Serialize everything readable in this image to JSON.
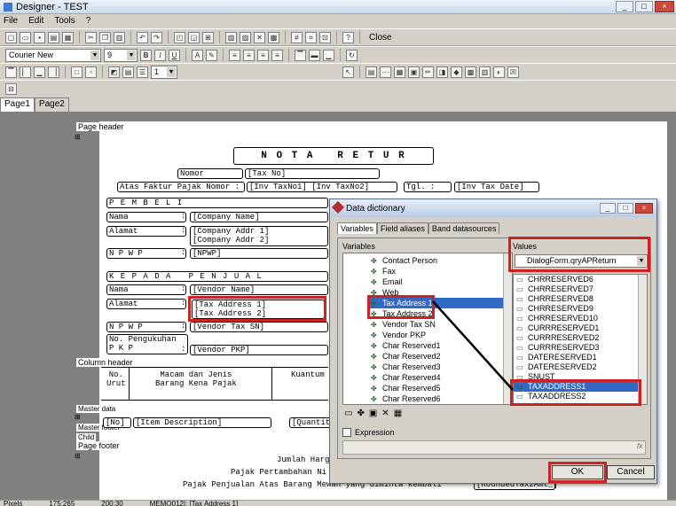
{
  "window": {
    "title": "Designer - TEST",
    "controls": [
      "_",
      "□",
      "×"
    ]
  },
  "menu": [
    "File",
    "Edit",
    "Tools",
    "?"
  ],
  "toolbar1": {
    "close_label": "Close"
  },
  "toolbar2": {
    "font": "Courier New",
    "size": "9",
    "bold": "B",
    "italic": "I",
    "underline": "U"
  },
  "toolbar3": {
    "line_width": "1"
  },
  "tabs": [
    "Page1",
    "Page2"
  ],
  "bands": {
    "page_header": "Page header",
    "column_header": "Column header",
    "master_data": "Master data",
    "master_footer": "Master footer",
    "child": "Child",
    "page_footer": "Page footer"
  },
  "report": {
    "title": "N O T A   R E T U R",
    "nomor_label": "Nomor",
    "nomor_value": "[Tax No]",
    "faktur_label": "Atas Faktur Pajak Nomor :",
    "faktur_value": "[Inv TaxNo1] [Inv TaxNo2]",
    "tgl_label": "Tgl. :",
    "tgl_value": "[Inv Tax Date]",
    "pembeli": "P E M B E L I",
    "nama": "Nama",
    "company_name": "[Company Name]",
    "alamat": "Alamat",
    "company_addr": "[Company Addr 1]\n[Company Addr 2]",
    "npwp": "N P W P",
    "npwp_value": "[NPWP]",
    "kepada": "K E P A D A   P E N J U A L",
    "vendor_name": "[Vendor Name]",
    "tax_address": "[Tax Address 1]\n[Tax Address 2]",
    "vendor_tax": "[Vendor Tax SN]",
    "pengukuhan": "No. Pengukuhan\nP K P",
    "vendor_pkp": "[Vendor PKP]",
    "col_no": "No.\nUrut",
    "col_macam": "Macam dan Jenis\nBarang Kena Pajak",
    "col_kuantum": "Kuantum",
    "row_no": "[No]",
    "row_desc": "[Item Description]",
    "row_qty": "[Quantit",
    "jumlah": "Jumlah Harg",
    "ppn": "Pajak Pertambahan Ni",
    "ppnbm": "Pajak Penjualan Atas Barang Mewah yang diminta kembali",
    "rounded": "[RoundedTax2Amt_]",
    "colon": ":"
  },
  "dialog": {
    "title": "Data dictionary",
    "tabs": [
      "Variables",
      "Field aliases",
      "Band datasources"
    ],
    "variables_label": "Variables",
    "variables": [
      "Contact Person",
      "Fax",
      "Email",
      "Web",
      "Tax Address 1",
      "Tax Address 2",
      "Vendor Tax SN",
      "Vendor PKP",
      "Char Reserved1",
      "Char Reserved2",
      "Char Reserved3",
      "Char Reserved4",
      "Char Reserved5",
      "Char Reserved6"
    ],
    "values_label": "Values",
    "values_source": "DialogForm.qryAPReturn",
    "values": [
      "CHRRESERVED6",
      "CHRRESERVED7",
      "CHRRESERVED8",
      "CHRRESERVED9",
      "CHRRESERVED10",
      "CURRRESERVED1",
      "CURRRESERVED2",
      "CURRRESERVED3",
      "DATERESERVED1",
      "DATERESERVED2",
      "SNUST",
      "TAXADDRESS1",
      "TAXADDRESS2"
    ],
    "expression_label": "Expression",
    "fx": "fx",
    "ok_label": "OK",
    "cancel_label": "Cancel"
  },
  "status": {
    "units": "Pixels",
    "pos1": "175;265",
    "pos2": "200;30",
    "memo": "MEMO012|: [Tax Address 1]"
  },
  "colors": {
    "highlight": "#d02020",
    "selection": "#316ac5"
  }
}
